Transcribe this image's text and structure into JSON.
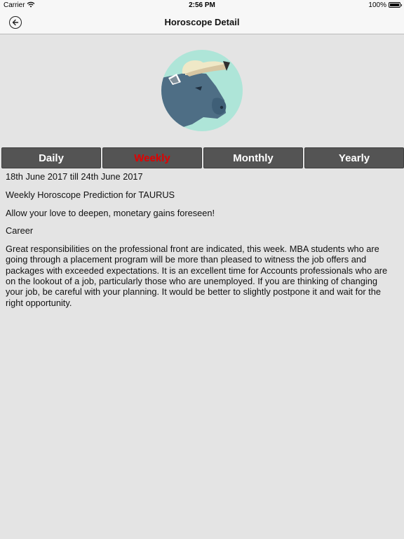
{
  "status_bar": {
    "carrier": "Carrier",
    "time": "2:56 PM",
    "battery": "100%"
  },
  "nav": {
    "title": "Horoscope Detail",
    "back_icon": "back-arrow-circle-icon"
  },
  "zodiac_image": {
    "sign": "taurus-bull-icon",
    "colors": {
      "circle": "#aee5d8",
      "head": "#4e6e85",
      "horn": "#efe8c7",
      "snout": "#3f5f77"
    }
  },
  "tabs": [
    {
      "label": "Daily",
      "active": false
    },
    {
      "label": "Weekly",
      "active": true
    },
    {
      "label": "Monthly",
      "active": false
    },
    {
      "label": "Yearly",
      "active": false
    }
  ],
  "content": {
    "date_range": "18th June 2017 till 24th June 2017",
    "heading": "Weekly Horoscope Prediction for TAURUS",
    "summary": "Allow your love to deepen, monetary gains foreseen!",
    "section_title": "Career",
    "body": "Great responsibilities on the professional front are indicated, this week. MBA students who are going through a placement program will be more than pleased to witness the job offers and packages with exceeded expectations. It is an excellent time for Accounts professionals who are on the lookout of a job, particularly those who are unemployed. If you are thinking of changing your job, be careful with your planning. It would be better to slightly postpone it and wait for the right opportunity."
  },
  "colors": {
    "background": "#e4e4e4",
    "tab_background": "#545454",
    "active_tab_text": "#e00000"
  }
}
